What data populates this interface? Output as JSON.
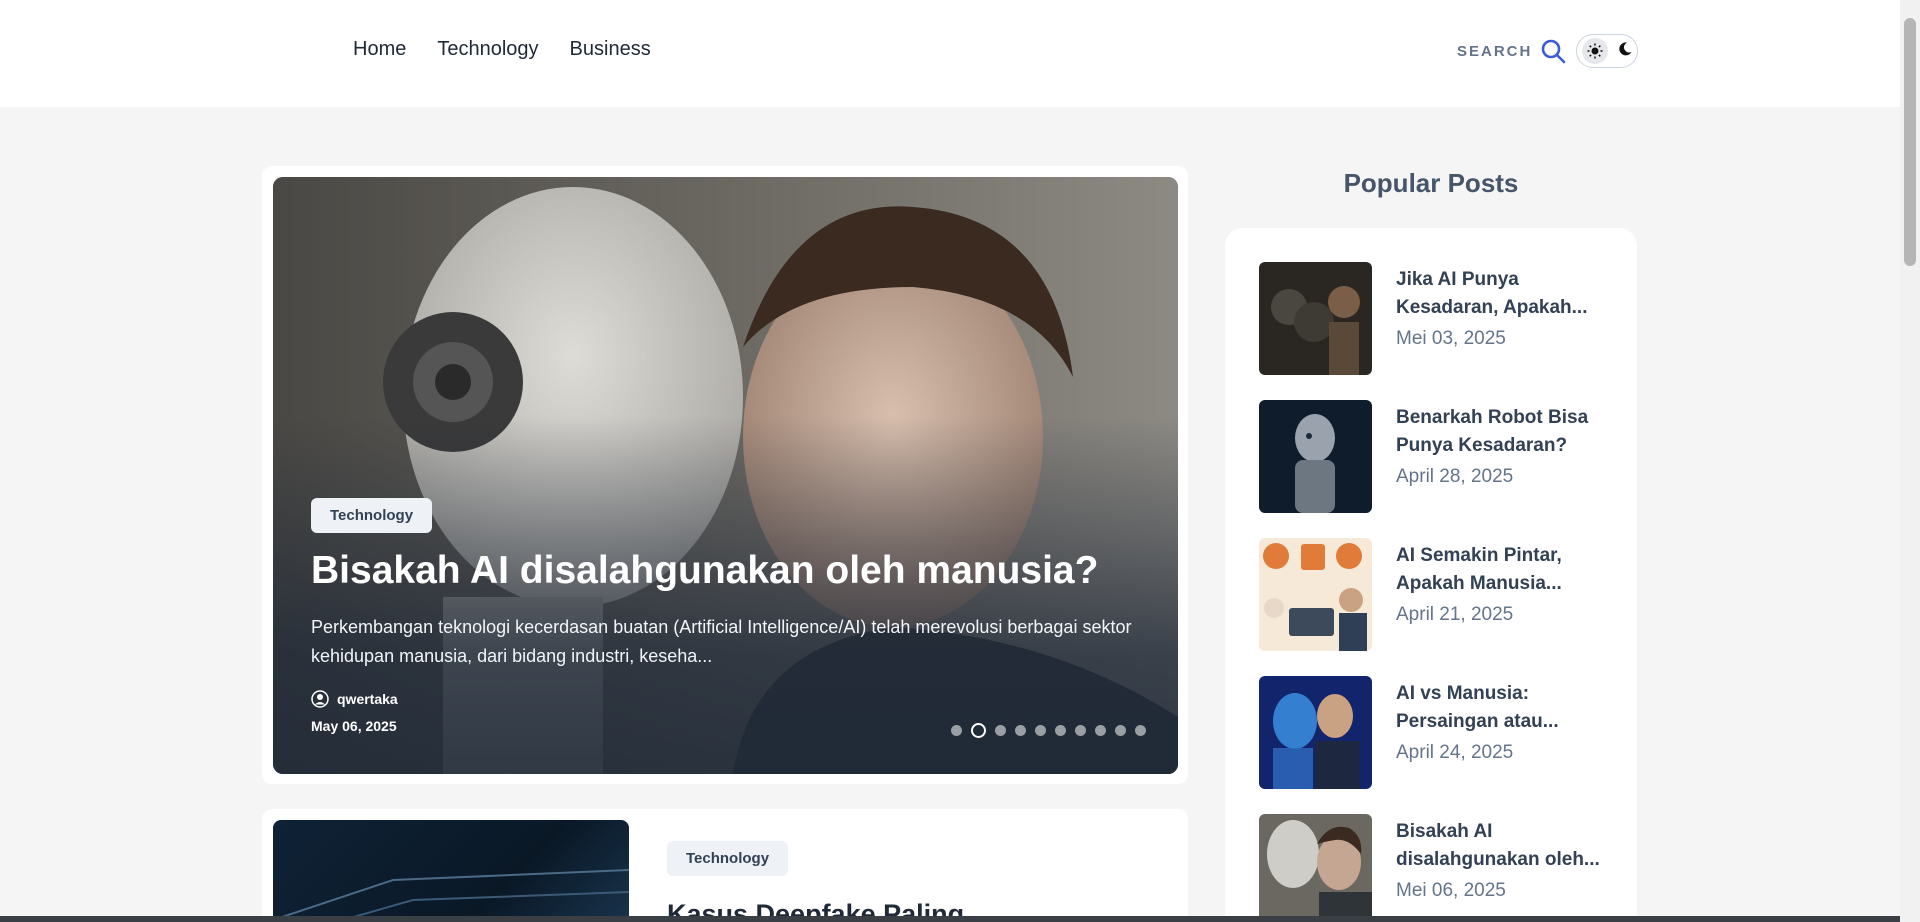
{
  "nav": {
    "items": [
      "Home",
      "Technology",
      "Business"
    ]
  },
  "header": {
    "search_label": "SEARCH",
    "search_icon": "search-icon",
    "theme_toggle_icons": [
      "sun-icon",
      "moon-icon"
    ]
  },
  "hero": {
    "category": "Technology",
    "title": "Bisakah AI disalahgunakan oleh manusia?",
    "excerpt": "Perkembangan teknologi kecerdasan buatan (Artificial Intelligence/AI) telah merevolusi berbagai sektor kehidupan manusia, dari bidang industri, keseha...",
    "author": "qwertaka",
    "date": "May 06, 2025",
    "slide_count": 10,
    "active_slide": 1
  },
  "post": {
    "category": "Technology",
    "title": "Kasus Deepfake Paling"
  },
  "sidebar": {
    "title": "Popular Posts",
    "items": [
      {
        "title": "Jika AI Punya Kesadaran, Apakah...",
        "date": "Mei 03, 2025"
      },
      {
        "title": "Benarkah Robot Bisa Punya Kesadaran?",
        "date": "April 28, 2025"
      },
      {
        "title": "AI Semakin Pintar, Apakah Manusia...",
        "date": "April 21, 2025"
      },
      {
        "title": "AI vs Manusia: Persaingan atau...",
        "date": "April 24, 2025"
      },
      {
        "title": "Bisakah AI disalahgunakan oleh...",
        "date": "Mei 06, 2025"
      }
    ]
  },
  "colors": {
    "accent": "#3b5bdb",
    "badge_bg": "#eef2f7",
    "text": "#1f2937"
  }
}
